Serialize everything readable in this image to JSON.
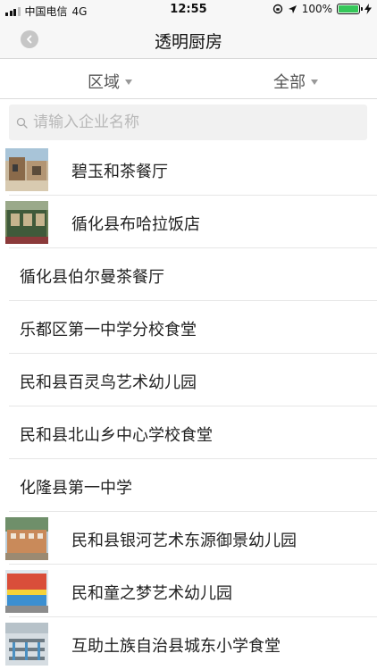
{
  "status": {
    "carrier": "中国电信",
    "network": "4G",
    "time": "12:55",
    "battery": "100%"
  },
  "nav": {
    "title": "透明厨房"
  },
  "filters": {
    "area_label": "区域",
    "category_label": "全部"
  },
  "search": {
    "placeholder": "请输入企业名称"
  },
  "list": [
    {
      "name": "碧玉和茶餐厅",
      "thumb": "restaurant-photo-1"
    },
    {
      "name": "循化县布哈拉饭店",
      "thumb": "restaurant-photo-2"
    },
    {
      "name": "循化县伯尔曼茶餐厅",
      "thumb": null
    },
    {
      "name": "乐都区第一中学分校食堂",
      "thumb": null
    },
    {
      "name": "民和县百灵鸟艺术幼儿园",
      "thumb": null
    },
    {
      "name": "民和县北山乡中心学校食堂",
      "thumb": null
    },
    {
      "name": "化隆县第一中学",
      "thumb": null
    },
    {
      "name": "民和县银河艺术东源御景幼儿园",
      "thumb": "restaurant-photo-3"
    },
    {
      "name": "民和童之梦艺术幼儿园",
      "thumb": "restaurant-photo-4"
    },
    {
      "name": "互助土族自治县城东小学食堂",
      "thumb": "restaurant-photo-5"
    }
  ]
}
